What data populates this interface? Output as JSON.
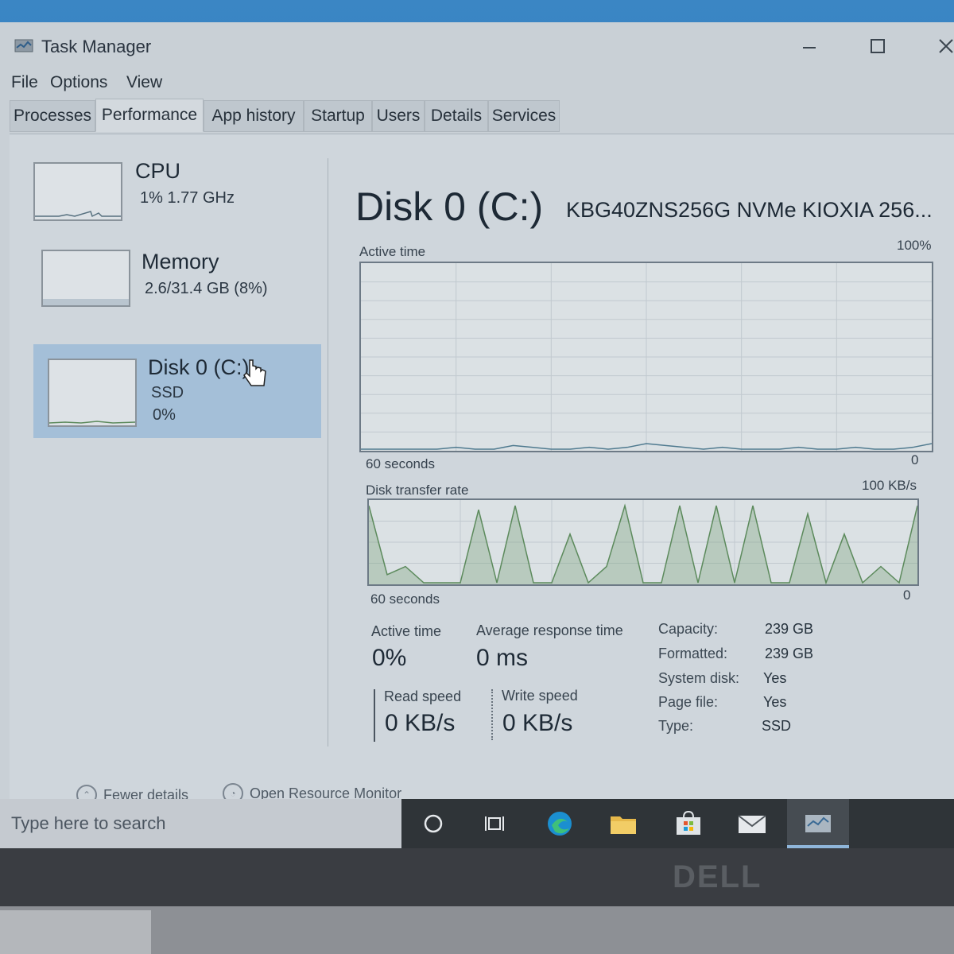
{
  "window": {
    "title": "Task Manager"
  },
  "menu": [
    "File",
    "Options",
    "View"
  ],
  "tabs": [
    "Processes",
    "Performance",
    "App history",
    "Startup",
    "Users",
    "Details",
    "Services"
  ],
  "active_tab": "Performance",
  "sidebar": {
    "cpu": {
      "title": "CPU",
      "detail": "1%  1.77 GHz"
    },
    "memory": {
      "title": "Memory",
      "detail": "2.6/31.4 GB (8%)"
    },
    "disk": {
      "title": "Disk 0 (C:)",
      "type": "SSD",
      "usage": "0%"
    }
  },
  "disk": {
    "title": "Disk 0 (C:)",
    "model": "KBG40ZNS256G NVMe KIOXIA 256...",
    "active_chart": {
      "label": "Active time",
      "max": "100%",
      "min": "0",
      "span": "60 seconds"
    },
    "transfer_chart": {
      "label": "Disk transfer rate",
      "max": "100 KB/s",
      "min": "0",
      "span": "60 seconds"
    },
    "stats": {
      "active_time_label": "Active time",
      "active_time": "0%",
      "response_label": "Average response time",
      "response": "0 ms",
      "read_label": "Read speed",
      "read": "0 KB/s",
      "write_label": "Write speed",
      "write": "0 KB/s"
    },
    "properties": [
      {
        "label": "Capacity:",
        "value": "239 GB"
      },
      {
        "label": "Formatted:",
        "value": "239 GB"
      },
      {
        "label": "System disk:",
        "value": "Yes"
      },
      {
        "label": "Page file:",
        "value": "Yes"
      },
      {
        "label": "Type:",
        "value": "SSD"
      }
    ]
  },
  "footer": {
    "fewer_details": "Fewer details",
    "resource_monitor": "Open Resource Monitor"
  },
  "taskbar": {
    "search_placeholder": "Type here to search"
  },
  "chart_data": [
    {
      "type": "line",
      "title": "Active time",
      "ylim": [
        0,
        100
      ],
      "x": [
        0,
        2,
        4,
        6,
        8,
        10,
        12,
        14,
        16,
        18,
        20,
        22,
        24,
        26,
        28,
        30,
        32,
        34,
        36,
        38,
        40,
        42,
        44,
        46,
        48,
        50,
        52,
        54,
        56,
        58,
        60
      ],
      "series": [
        {
          "values": [
            0,
            0,
            0,
            0,
            0,
            1,
            0,
            0,
            2,
            1,
            0,
            0,
            1,
            0,
            1,
            3,
            2,
            1,
            0,
            1,
            0,
            0,
            0,
            1,
            0,
            0,
            1,
            0,
            0,
            1,
            3
          ]
        }
      ]
    },
    {
      "type": "area",
      "title": "Disk transfer rate",
      "ylim": [
        0,
        100
      ],
      "x": [
        0,
        2,
        4,
        6,
        8,
        10,
        12,
        14,
        16,
        18,
        20,
        22,
        24,
        26,
        28,
        30,
        32,
        34,
        36,
        38,
        40,
        42,
        44,
        46,
        48,
        50,
        52,
        54,
        56,
        58,
        60
      ],
      "series": [
        {
          "values": [
            95,
            10,
            20,
            0,
            0,
            0,
            90,
            0,
            95,
            0,
            0,
            60,
            0,
            20,
            95,
            0,
            0,
            95,
            0,
            95,
            0,
            95,
            0,
            0,
            85,
            0,
            60,
            0,
            20,
            0,
            95
          ]
        }
      ]
    }
  ],
  "colors": {
    "selected": "#a4bfd8",
    "chart_line": "#4f7a8f",
    "transfer_line": "#5c8a5c",
    "grid": "#c1c9cf"
  }
}
